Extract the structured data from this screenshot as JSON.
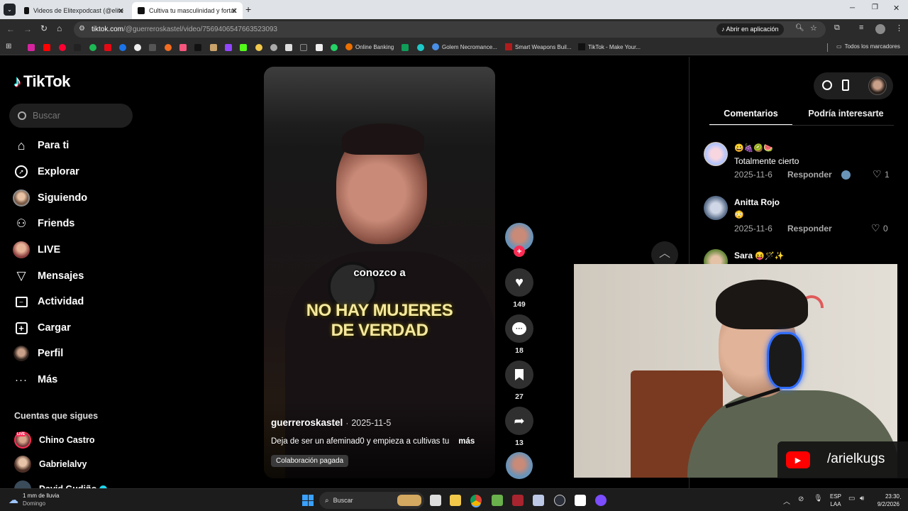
{
  "browser": {
    "tabs": [
      {
        "title": "Videos de Elitexpodcast (@elite"
      },
      {
        "title": "Cultiva tu masculinidad y fortal"
      }
    ],
    "url_host": "tiktok.com",
    "url_path": "/@guerreroskastel/video/7569406547663523093",
    "open_in_app": "Abrir en aplicación",
    "bookmarks": [
      "Online Banking",
      "Golem Necromance...",
      "Smart Weapons Buil...",
      "TikTok - Make Your..."
    ],
    "all_bookmarks": "Todos los marcadores"
  },
  "sidebar": {
    "logo": "TikTok",
    "search_placeholder": "Buscar",
    "nav": [
      {
        "label": "Para ti",
        "icon": "home-icon"
      },
      {
        "label": "Explorar",
        "icon": "compass-icon"
      },
      {
        "label": "Siguiendo",
        "icon": "following-avatar"
      },
      {
        "label": "Friends",
        "icon": "friends-icon"
      },
      {
        "label": "LIVE",
        "icon": "live-avatar"
      },
      {
        "label": "Mensajes",
        "icon": "send-icon"
      },
      {
        "label": "Actividad",
        "icon": "activity-icon"
      },
      {
        "label": "Cargar",
        "icon": "upload-icon"
      },
      {
        "label": "Perfil",
        "icon": "profile-avatar"
      },
      {
        "label": "Más",
        "icon": "more-icon"
      }
    ],
    "following_title": "Cuentas que sigues",
    "following": [
      {
        "name": "Chino Castro",
        "live_badge": "LIVE"
      },
      {
        "name": "Gabrielalvy"
      },
      {
        "name": "David Gudiño"
      }
    ]
  },
  "video": {
    "caption_small": "conozco a",
    "caption_big_1": "NO HAY MUJERES",
    "caption_big_2": "DE VERDAD",
    "author": "guerreroskastel",
    "date": "2025-11-5",
    "description": "Deja de ser un afeminad0 y empieza a cultivas tu",
    "more": "más",
    "badge": "Colaboración pagada",
    "likes": "149",
    "comments": "18",
    "saves": "27",
    "shares": "13"
  },
  "panel": {
    "tab_comments": "Comentarios",
    "tab_interest": "Podría interesarte",
    "reply": "Responder",
    "comments": [
      {
        "user": "",
        "emoji": "😀🍇🥝🍉",
        "text": "Totalmente cierto",
        "date": "2025-11-6",
        "likes": "1"
      },
      {
        "user": "Anitta Rojo",
        "emoji": "",
        "text": "😳",
        "date": "2025-11-6",
        "likes": "0"
      },
      {
        "user": "Sara",
        "emoji": "😝🪄✨",
        "text": "",
        "date": "",
        "likes": ""
      }
    ]
  },
  "webcam": {
    "channel": "/arielkugs"
  },
  "taskbar": {
    "weather_main": "1 mm de lluvia",
    "weather_sub": "Domingo",
    "search": "Buscar",
    "lang_1": "ESP",
    "lang_2": "LAA",
    "time": "23:30",
    "date": "9/2/2026"
  },
  "colors": {
    "accent_pink": "#fe2c55",
    "youtube_red": "#ff0000",
    "caption_yellow": "#f5e9a0"
  }
}
